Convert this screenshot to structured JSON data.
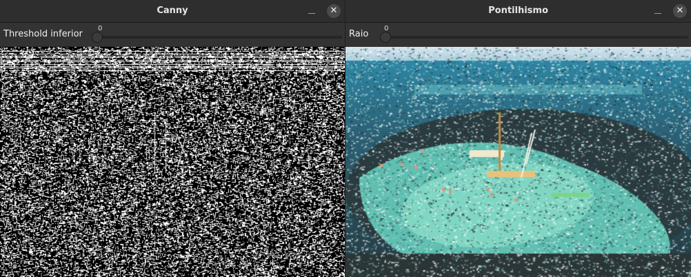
{
  "windows": {
    "canny": {
      "title": "Canny",
      "trackbar_label": "Threshold inferior",
      "trackbar_value": "0",
      "close_glyph": "✕"
    },
    "pontilhismo": {
      "title": "Pontilhismo",
      "trackbar_label": "Raio",
      "trackbar_value": "0",
      "close_glyph": "✕"
    }
  },
  "colors": {
    "titlebar": "#2e2e2e",
    "trackbar_bg": "#333333",
    "sea_deep": "#2e5f74",
    "shallow_lagoon": "#6ec9b8",
    "reef_dark": "#2a3a3e",
    "canny_edge": "#ffffff"
  },
  "icons": {
    "minimize": "minimize-icon",
    "close": "close-icon"
  }
}
